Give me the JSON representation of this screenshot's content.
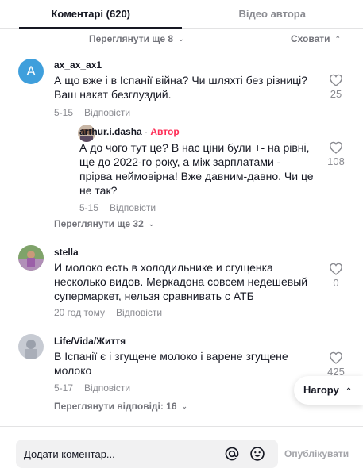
{
  "tabs": [
    {
      "label": "Коментарі (620)"
    },
    {
      "label": "Відео автора"
    }
  ],
  "thread_controls": {
    "more_label": "Переглянути ще 8",
    "hide_label": "Сховати"
  },
  "comments": [
    {
      "avatar_letter": "A",
      "username": "ax_ax_ax1",
      "text": "А що вже і в Іспанії війна? Чи шляхті без різниці? Ваш накат безглуздий.",
      "date": "5-15",
      "reply_label": "Відповісти",
      "likes": "25"
    },
    {
      "username": "arthur.i.dasha",
      "author_separator": "·",
      "author_label": "Автор",
      "text": "А до чого тут це? В нас ціни були +- на рівні, ще до 2022-го року, а між зарплатами - прірва неймовірна! Вже давним-давно. Чи це не так?",
      "date": "5-15",
      "reply_label": "Відповісти",
      "likes": "108",
      "view_more_label": "Переглянути ще 32"
    },
    {
      "username": "stella",
      "text": "И молоко есть в холодильнике и сгущенка несколько видов. Меркадона совсем недешевый супермаркет, нельзя сравнивать с АТБ",
      "date": "20 год тому",
      "reply_label": "Відповісти",
      "likes": "0"
    },
    {
      "username": "Life/Vida/Життя",
      "text": "В Іспанії є і згущене молоко і варене згущене молоко",
      "date": "5-17",
      "reply_label": "Відповісти",
      "likes": "425",
      "view_replies_label": "Переглянути відповіді: 16"
    }
  ],
  "back_to_top": {
    "label": "Нагору"
  },
  "composer": {
    "placeholder": "Додати коментар...",
    "post_label": "Опублікувати"
  },
  "colors": {
    "author_accent": "#fe2c55",
    "avatar_letter_bg": "#3f9fdc"
  }
}
